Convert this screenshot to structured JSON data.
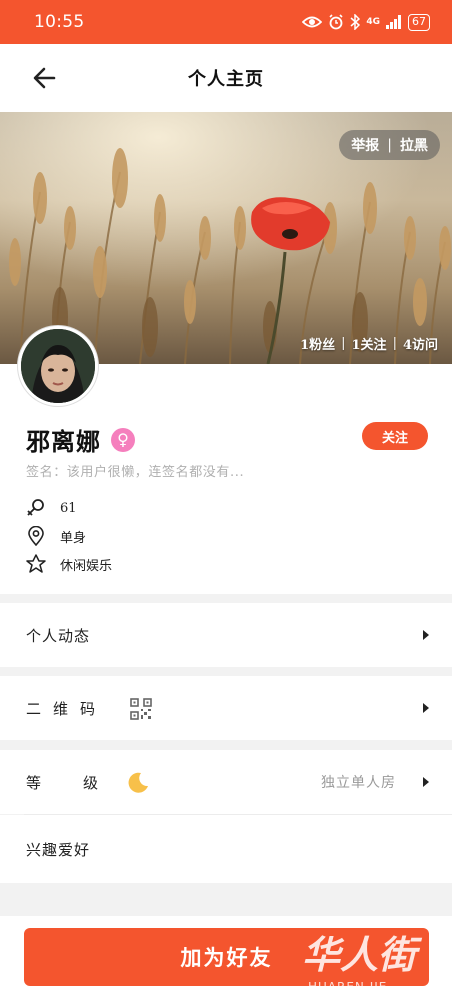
{
  "status_bar": {
    "time": "10:55",
    "network": "4G",
    "battery": "67"
  },
  "header": {
    "title": "个人主页"
  },
  "cover": {
    "report": "举报",
    "separator": "|",
    "block": "拉黑",
    "stats": {
      "fans": "1粉丝",
      "following": "1关注",
      "visits": "4访问"
    }
  },
  "profile": {
    "name": "邪离娜",
    "gender_symbol": "♀",
    "follow_label": "关注",
    "signature": "签名：该用户很懒，连签名都没有...",
    "age": "61",
    "relationship": "单身",
    "hobby_tag": "休闲娱乐"
  },
  "menu": {
    "dynamics": "个人动态",
    "qrcode": "二维码",
    "level_label": "等级",
    "level_value": "独立单人房",
    "interests": "兴趣爱好"
  },
  "footer": {
    "add_friend": "加为好友"
  },
  "watermark": {
    "text": "华人街",
    "subtext": "HUAREN JIE"
  },
  "colors": {
    "accent": "#f4552e",
    "gender_badge": "#f57fbd",
    "background": "#f2f2f2"
  }
}
